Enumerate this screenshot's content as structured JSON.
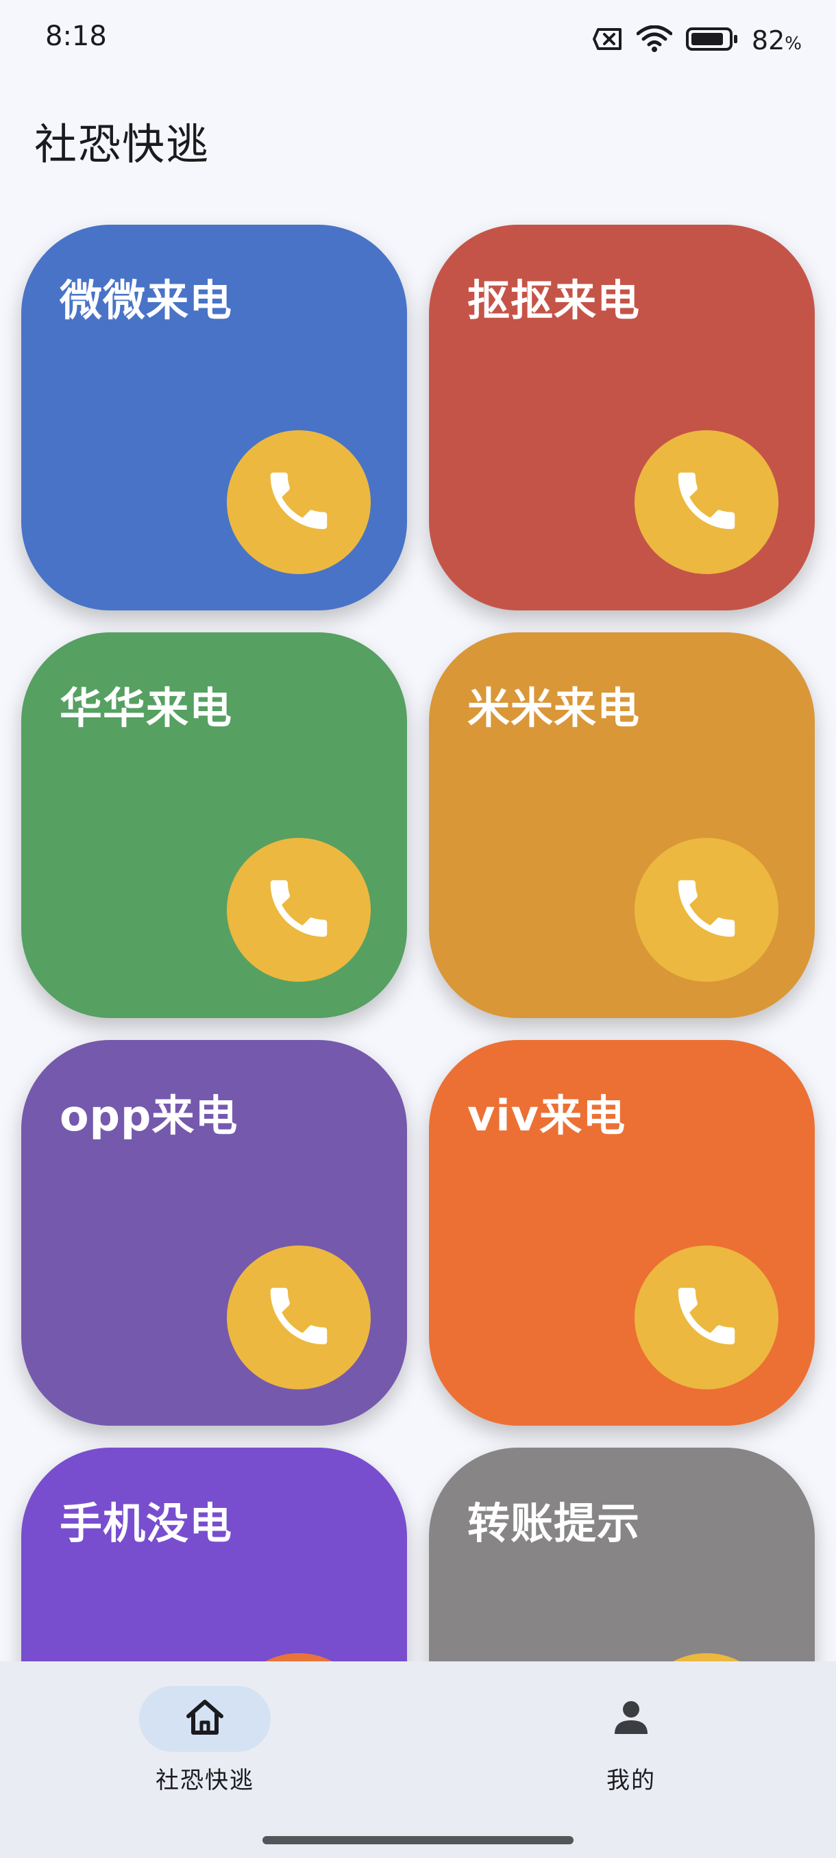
{
  "status_bar": {
    "time": "8:18",
    "battery_percent": "82",
    "battery_unit": "%",
    "battery_level": 0.82,
    "icons": [
      "sim-error-icon",
      "wifi-icon",
      "battery-icon"
    ]
  },
  "header": {
    "title": "社恐快逃"
  },
  "cards": [
    {
      "label": "微微来电",
      "color": "#4873c7",
      "icon": "phone-icon"
    },
    {
      "label": "抠抠来电",
      "color": "#c55448",
      "icon": "phone-icon"
    },
    {
      "label": "华华来电",
      "color": "#56a062",
      "icon": "phone-icon"
    },
    {
      "label": "米米来电",
      "color": "#d99738",
      "icon": "phone-icon"
    },
    {
      "label": "opp来电",
      "color": "#7559ad",
      "icon": "phone-icon"
    },
    {
      "label": "viv来电",
      "color": "#ec7034",
      "icon": "phone-icon"
    },
    {
      "label": "手机没电",
      "color": "#784ecf",
      "icon": "phone-icon"
    },
    {
      "label": "转账提示",
      "color": "#878586",
      "icon": "phone-icon"
    }
  ],
  "colors": {
    "call_button": "#ecb83f",
    "card_call_button_alt": "#e8743a",
    "nav_active": "#d5e2f3",
    "nav_background": "#e9ecf2"
  },
  "bottom_nav": {
    "items": [
      {
        "label": "社恐快逃",
        "icon": "home-icon",
        "active": true
      },
      {
        "label": "我的",
        "icon": "person-icon",
        "active": false
      }
    ]
  }
}
